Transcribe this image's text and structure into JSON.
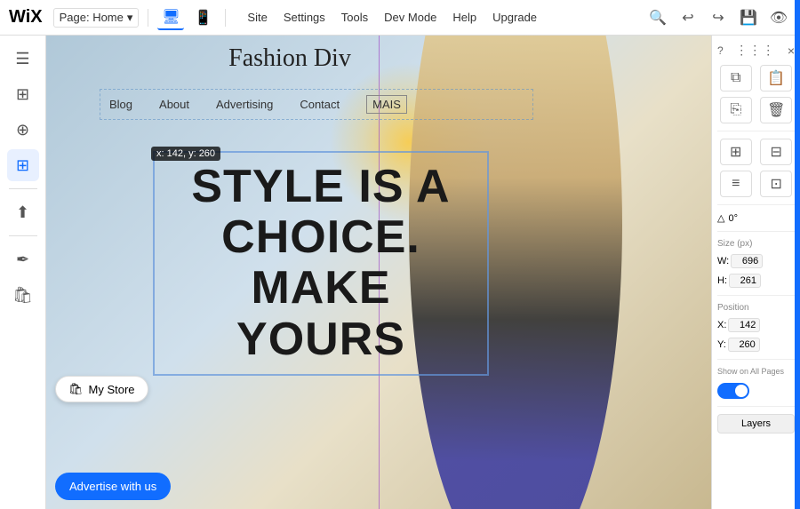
{
  "topbar": {
    "logo": "WiX",
    "page_selector": "Page: Home",
    "page_dropdown_icon": "▾",
    "desktop_icon": "🖥",
    "mobile_icon": "📱",
    "menu_items": [
      "Site",
      "Settings",
      "Tools",
      "Dev Mode",
      "Help",
      "Upgrade"
    ],
    "search_icon": "🔍",
    "undo_icon": "↩",
    "redo_icon": "↪",
    "save_icon": "💾",
    "preview_icon": "👁"
  },
  "left_sidebar": {
    "icons": [
      {
        "name": "pages-icon",
        "symbol": "☰"
      },
      {
        "name": "add-elements-icon",
        "symbol": "⊞"
      },
      {
        "name": "add-section-icon",
        "symbol": "⊕"
      },
      {
        "name": "apps-icon",
        "symbol": "⊞"
      },
      {
        "name": "upload-icon",
        "symbol": "⬆"
      },
      {
        "name": "blog-icon",
        "symbol": "✒"
      },
      {
        "name": "store-icon",
        "symbol": "🛍"
      }
    ],
    "my_store_label": "My Store"
  },
  "canvas": {
    "site_title": "Fashion Div",
    "coordinate_tooltip": "x: 142, y: 260",
    "nav_items": [
      "Blog",
      "About",
      "Advertising",
      "Contact",
      "MAIS"
    ],
    "headline": "STYLE IS A CHOICE. MAKE YOURS",
    "guide_line": true
  },
  "right_panel": {
    "help_label": "?",
    "dots_label": "⋮⋮⋮",
    "close_label": "×",
    "copy_icon": "⧉",
    "paste_icon": "📋",
    "duplicate_icon": "⎘",
    "delete_icon": "🗑",
    "group_icon": "⊞",
    "ungroup_icon": "⊟",
    "align_icon": "≡",
    "layout_icon": "⊡",
    "rotation_label": "0°",
    "size_section": "Size (px)",
    "width_label": "W:",
    "width_value": "696",
    "height_label": "H:",
    "height_value": "261",
    "position_section": "Position",
    "x_label": "X:",
    "x_value": "142",
    "y_label": "Y:",
    "y_value": "260",
    "show_all_pages_label": "Show on All Pages",
    "toggle_state": true,
    "layers_label": "Layers"
  },
  "advertise_btn": {
    "label": "Advertise with us"
  }
}
